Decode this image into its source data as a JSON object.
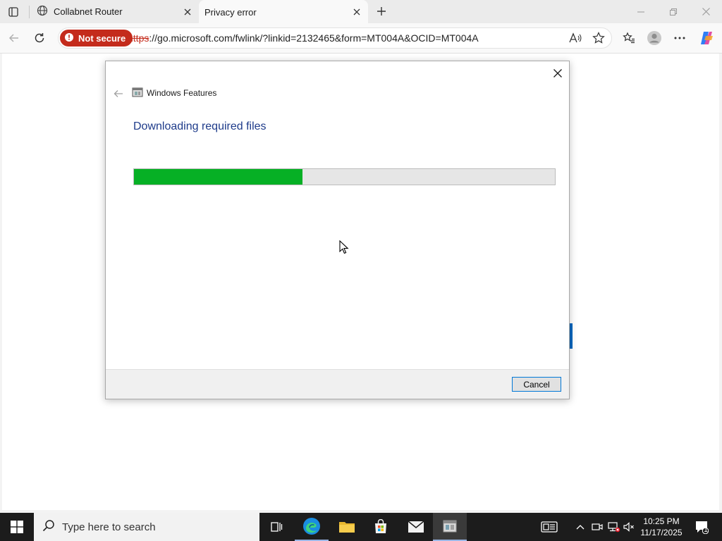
{
  "browser": {
    "tabs": [
      {
        "title": "Collabnet Router",
        "icon": "globe-icon"
      },
      {
        "title": "Privacy error",
        "icon": "none",
        "active": true
      }
    ],
    "security_badge": "Not secure",
    "url_scheme": "https",
    "url_rest": "://go.microsoft.com/fwlink/?linkid=2132465&form=MT004A&OCID=MT004A",
    "colors": {
      "not_secure": "#c42b1c",
      "tabstrip": "#ebebeb"
    }
  },
  "dialog": {
    "title": "Windows Features",
    "heading": "Downloading required files",
    "progress_fraction": 0.4,
    "cancel_label": "Cancel",
    "colors": {
      "heading": "#1e3b8a",
      "progress_fill": "#06b025"
    }
  },
  "taskbar": {
    "search_placeholder": "Type here to search",
    "time": "10:25 PM",
    "date": "11/17/2025",
    "notification_count": "1"
  }
}
